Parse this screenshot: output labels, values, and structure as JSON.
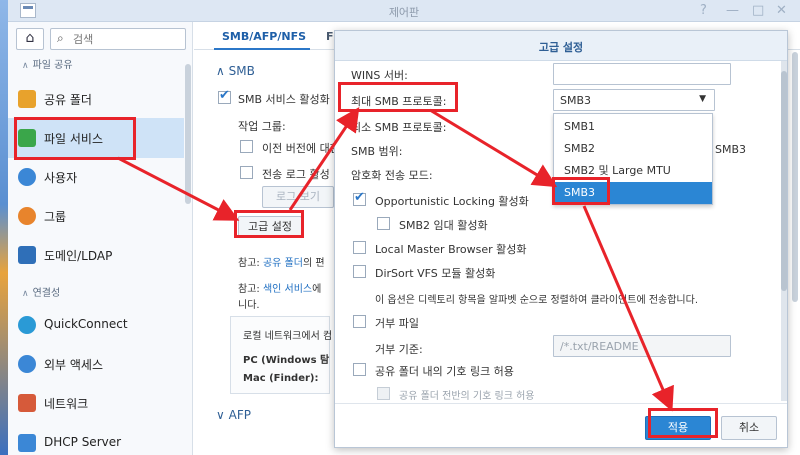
{
  "window": {
    "title": "제어판",
    "controls": [
      "?",
      "—",
      "□",
      "✕"
    ]
  },
  "sidebar": {
    "search_placeholder": "검색",
    "sections": [
      {
        "label": "파일 공유"
      },
      {
        "label": "연결성"
      }
    ],
    "items": [
      {
        "label": "공유 폴더",
        "icon": "shared-folder-icon",
        "color": "#e8a22c"
      },
      {
        "label": "파일 서비스",
        "icon": "file-services-icon",
        "color": "#3aa64a"
      },
      {
        "label": "사용자",
        "icon": "user-icon",
        "color": "#3b87d6"
      },
      {
        "label": "그룹",
        "icon": "group-icon",
        "color": "#e8842c"
      },
      {
        "label": "도메인/LDAP",
        "icon": "domain-ldap-icon",
        "color": "#2f6fb8"
      },
      {
        "label": "QuickConnect",
        "icon": "quickconnect-icon",
        "color": "#2a9ad6"
      },
      {
        "label": "외부 액세스",
        "icon": "external-access-icon",
        "color": "#3b87d6"
      },
      {
        "label": "네트워크",
        "icon": "network-icon",
        "color": "#d65a3a"
      },
      {
        "label": "DHCP Server",
        "icon": "dhcp-server-icon",
        "color": "#3b87d6"
      }
    ]
  },
  "content": {
    "tabs": [
      "SMB/AFP/NFS",
      "F"
    ],
    "smb_section": "SMB",
    "enable_smb": "SMB 서비스 활성화",
    "workgroup": "작업 그룹:",
    "prev_version": "이전 버전에 대한",
    "transfer_log": "전송 로그 활성",
    "log_button": "로그 보기",
    "advanced_button": "고급 설정",
    "note1_prefix": "참고: ",
    "note1_link": "공유 폴더",
    "note1_suffix": "의 편",
    "note2_prefix": "참고: ",
    "note2_link": "색인 서비스",
    "note2_suffix": "에 ",
    "note2_line2": "니다.",
    "info_line": "로컬 네트워크에서 컴",
    "info_pc": "PC (Windows 탐",
    "info_mac": "Mac (Finder):",
    "afp_section": "AFP"
  },
  "modal": {
    "title": "고급 설정",
    "wins_label": "WINS 서버:",
    "wins_value": "",
    "max_smb_label": "최대 SMB 프로토콜:",
    "max_smb_value": "SMB3",
    "min_smb_label": "최소 SMB 프로토콜:",
    "smb_range_label": "SMB 범위:",
    "smb_range_value": "SMB3",
    "encryption_label": "암호화 전송 모드:",
    "dropdown_options": [
      "SMB1",
      "SMB2",
      "SMB2 및 Large MTU",
      "SMB3"
    ],
    "dropdown_selected": "SMB3",
    "opportunistic_locking": "Opportunistic Locking 활성화",
    "smb2_lease": "SMB2 임대 활성화",
    "local_master_browser": "Local Master Browser 활성화",
    "dirsort": "DirSort VFS 모듈 활성화",
    "dirsort_desc": "이 옵션은 디렉토리 항목을 알파벳 순으로 정렬하여 클라이언트에 전송합니다.",
    "veto_files": "거부 파일",
    "veto_criteria_label": "거부 기준:",
    "veto_criteria_value": "/*.txt/README",
    "symlink_shared": "공유 폴더 내의 기호 링크 허용",
    "symlink_across": "공유 폴더 전반의 기호 링크 허용",
    "apply_button": "적용",
    "cancel_button": "취소"
  }
}
